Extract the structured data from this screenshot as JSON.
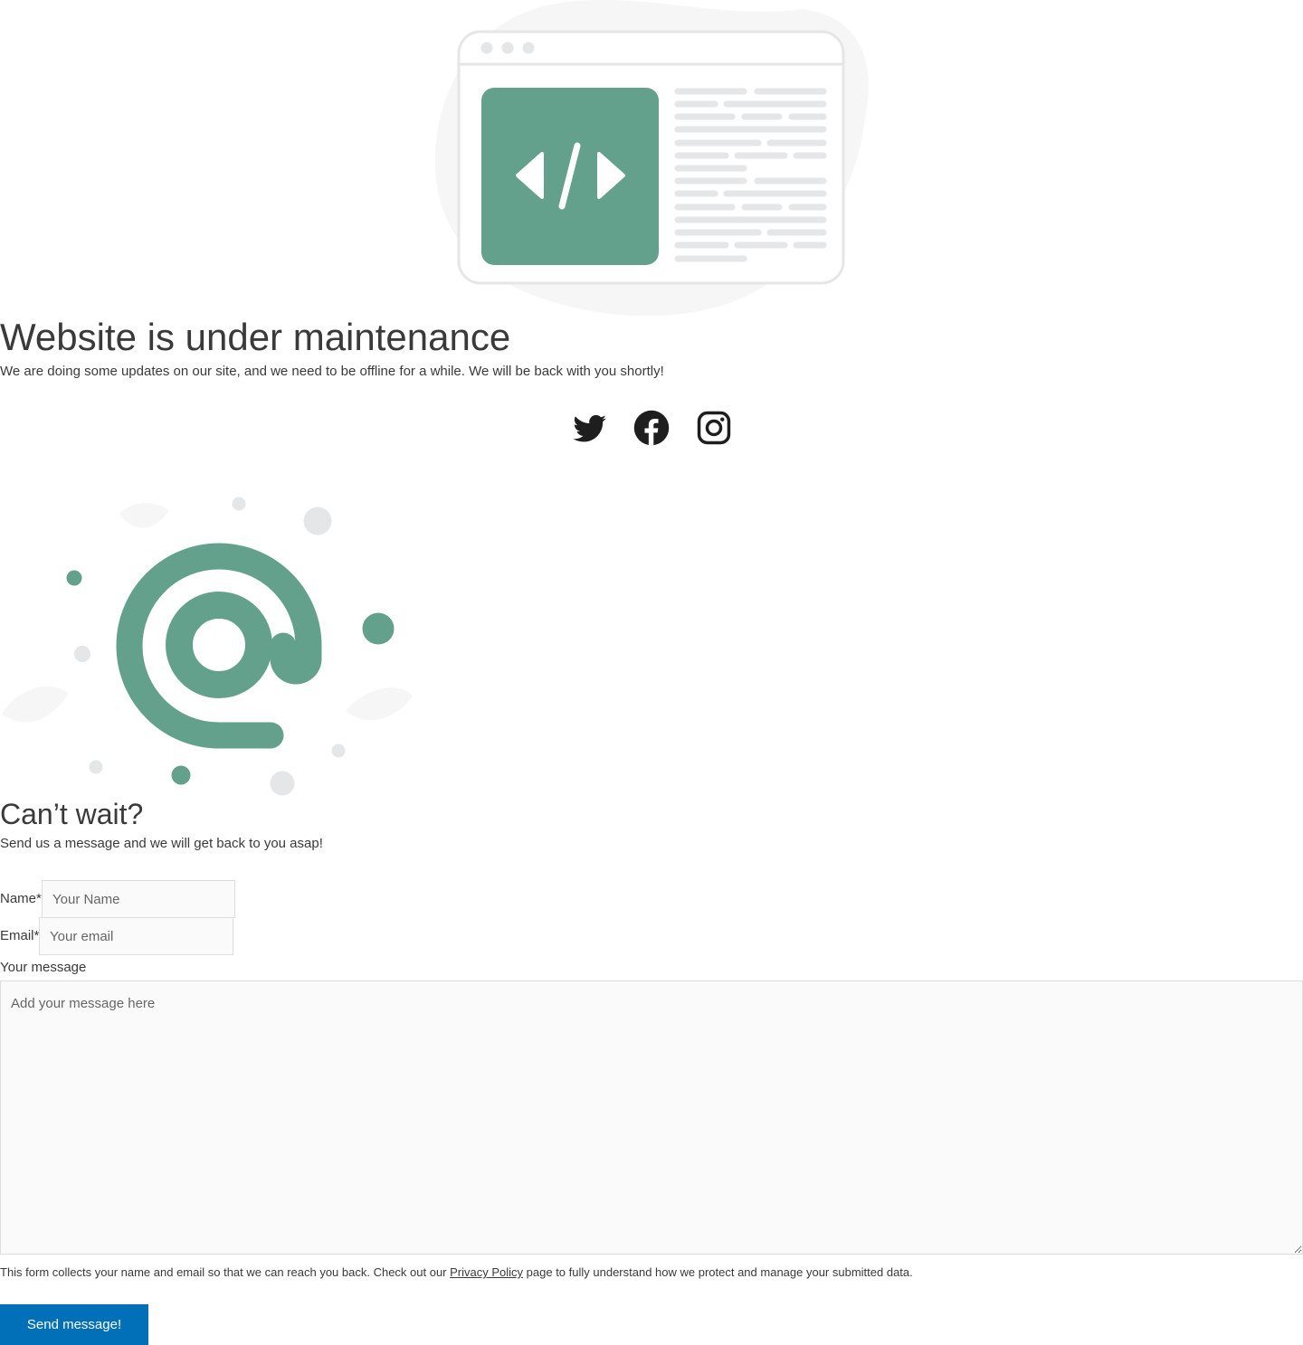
{
  "illustrations": {
    "hero": "browser-window-code-illustration",
    "contact": "at-sign-illustration"
  },
  "colors": {
    "accent_green": "#64a18d",
    "button_blue": "#0170b9",
    "text": "#3a3a3a",
    "placeholder_gray": "#e5e6e8"
  },
  "maintenance": {
    "title": "Website is under maintenance",
    "subtitle": "We are doing some updates on our site, and we need to be offline for a while. We will be back with you shortly!"
  },
  "social": [
    {
      "icon": "twitter-icon",
      "name": "Twitter"
    },
    {
      "icon": "facebook-icon",
      "name": "Facebook"
    },
    {
      "icon": "instagram-icon",
      "name": "Instagram"
    }
  ],
  "contact": {
    "title": "Can’t wait?",
    "subtitle": "Send us a message and we will get back to you asap!",
    "name_label": "Name*",
    "name_placeholder": "Your Name",
    "email_label": "Email*",
    "email_placeholder": "Your email",
    "message_label": "Your message",
    "message_placeholder": "Add your message here",
    "privacy_before": "This form collects your name and email so that we can reach you back. Check out our ",
    "privacy_link": "Privacy Policy",
    "privacy_after": " page to fully understand how we protect and manage your submitted data.",
    "submit_label": "Send message!"
  }
}
